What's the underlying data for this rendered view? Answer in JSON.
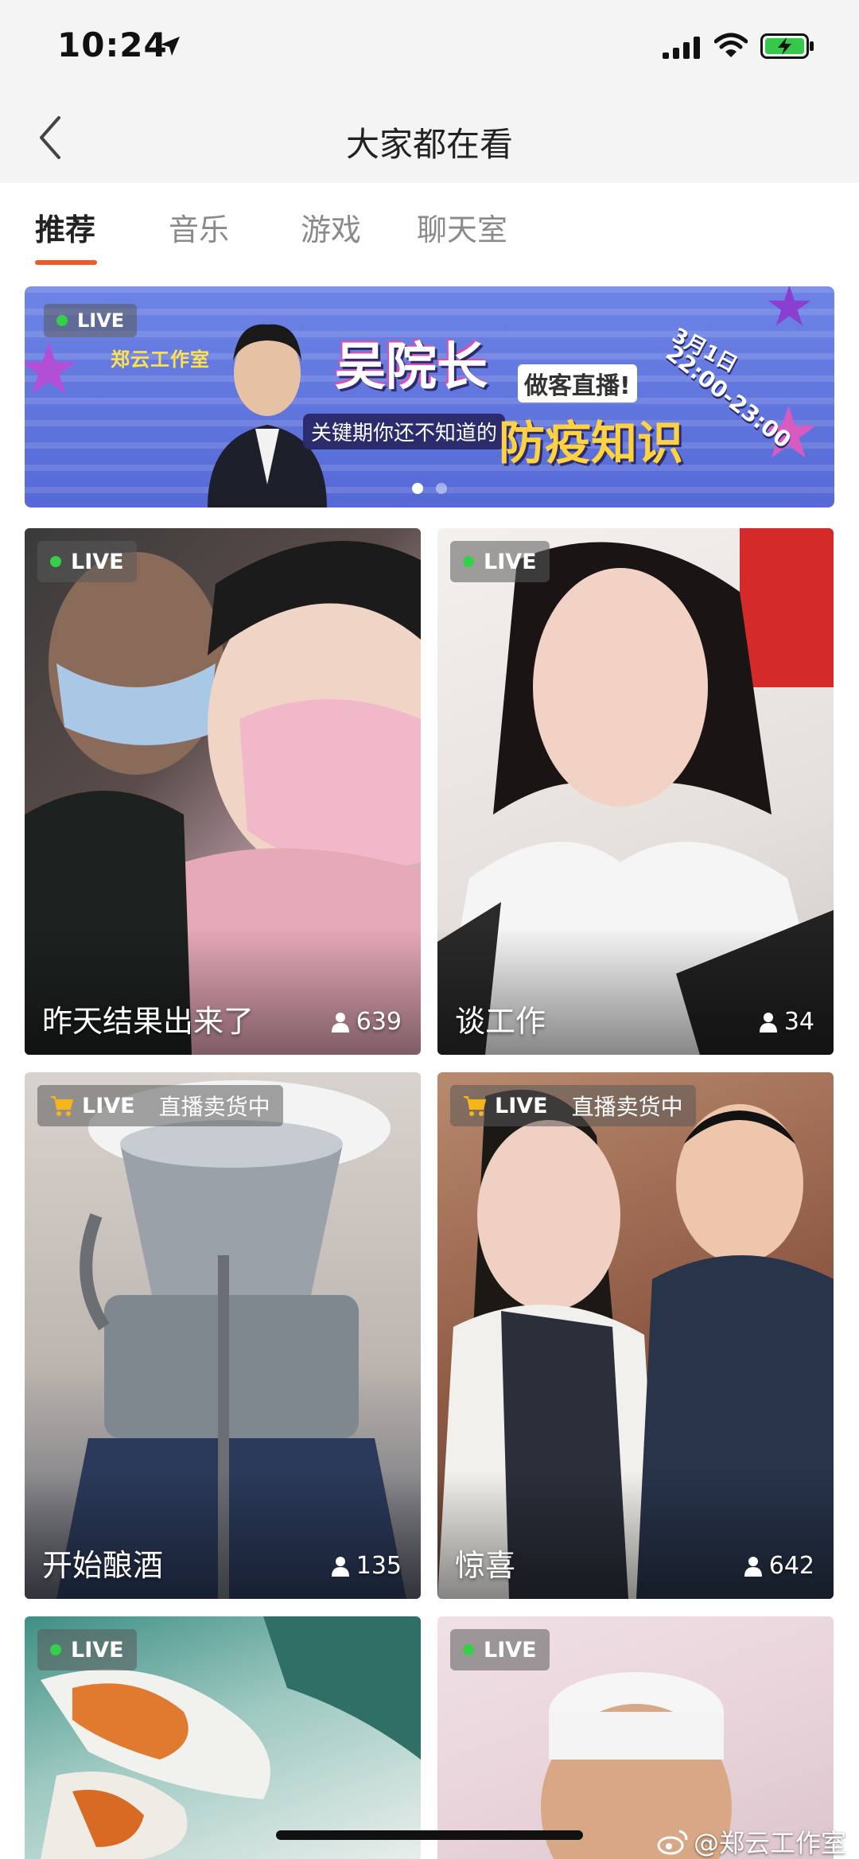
{
  "status_bar": {
    "time": "10:24"
  },
  "nav": {
    "title": "大家都在看"
  },
  "tabs": [
    {
      "label": "推荐",
      "active": true
    },
    {
      "label": "音乐",
      "active": false
    },
    {
      "label": "游戏",
      "active": false
    },
    {
      "label": "聊天室",
      "active": false
    }
  ],
  "banner": {
    "live_label": "LIVE",
    "studio": "郑云工作室",
    "headline": "吴院长",
    "tag": "做客直播!",
    "date": "3月1日",
    "time": "22:00-23:00",
    "subtitle": "关键期你还不知道的",
    "topic": "防疫知识",
    "page_count": 2,
    "active_page": 1
  },
  "cards": [
    {
      "live_label": "LIVE",
      "title": "昨天结果出来了",
      "viewers": "639",
      "selling": false
    },
    {
      "live_label": "LIVE",
      "title": "谈工作",
      "viewers": "34",
      "selling": false
    },
    {
      "live_label": "LIVE",
      "selling_label": "直播卖货中",
      "title": "开始酿酒",
      "viewers": "135",
      "selling": true
    },
    {
      "live_label": "LIVE",
      "selling_label": "直播卖货中",
      "title": "惊喜",
      "viewers": "642",
      "selling": true
    },
    {
      "live_label": "LIVE",
      "title": "",
      "viewers": "",
      "selling": false
    },
    {
      "live_label": "LIVE",
      "title": "",
      "viewers": "",
      "selling": false
    }
  ],
  "watermark": "@郑云工作室",
  "colors": {
    "accent": "#f35a24",
    "live_dot": "#35d04a"
  }
}
